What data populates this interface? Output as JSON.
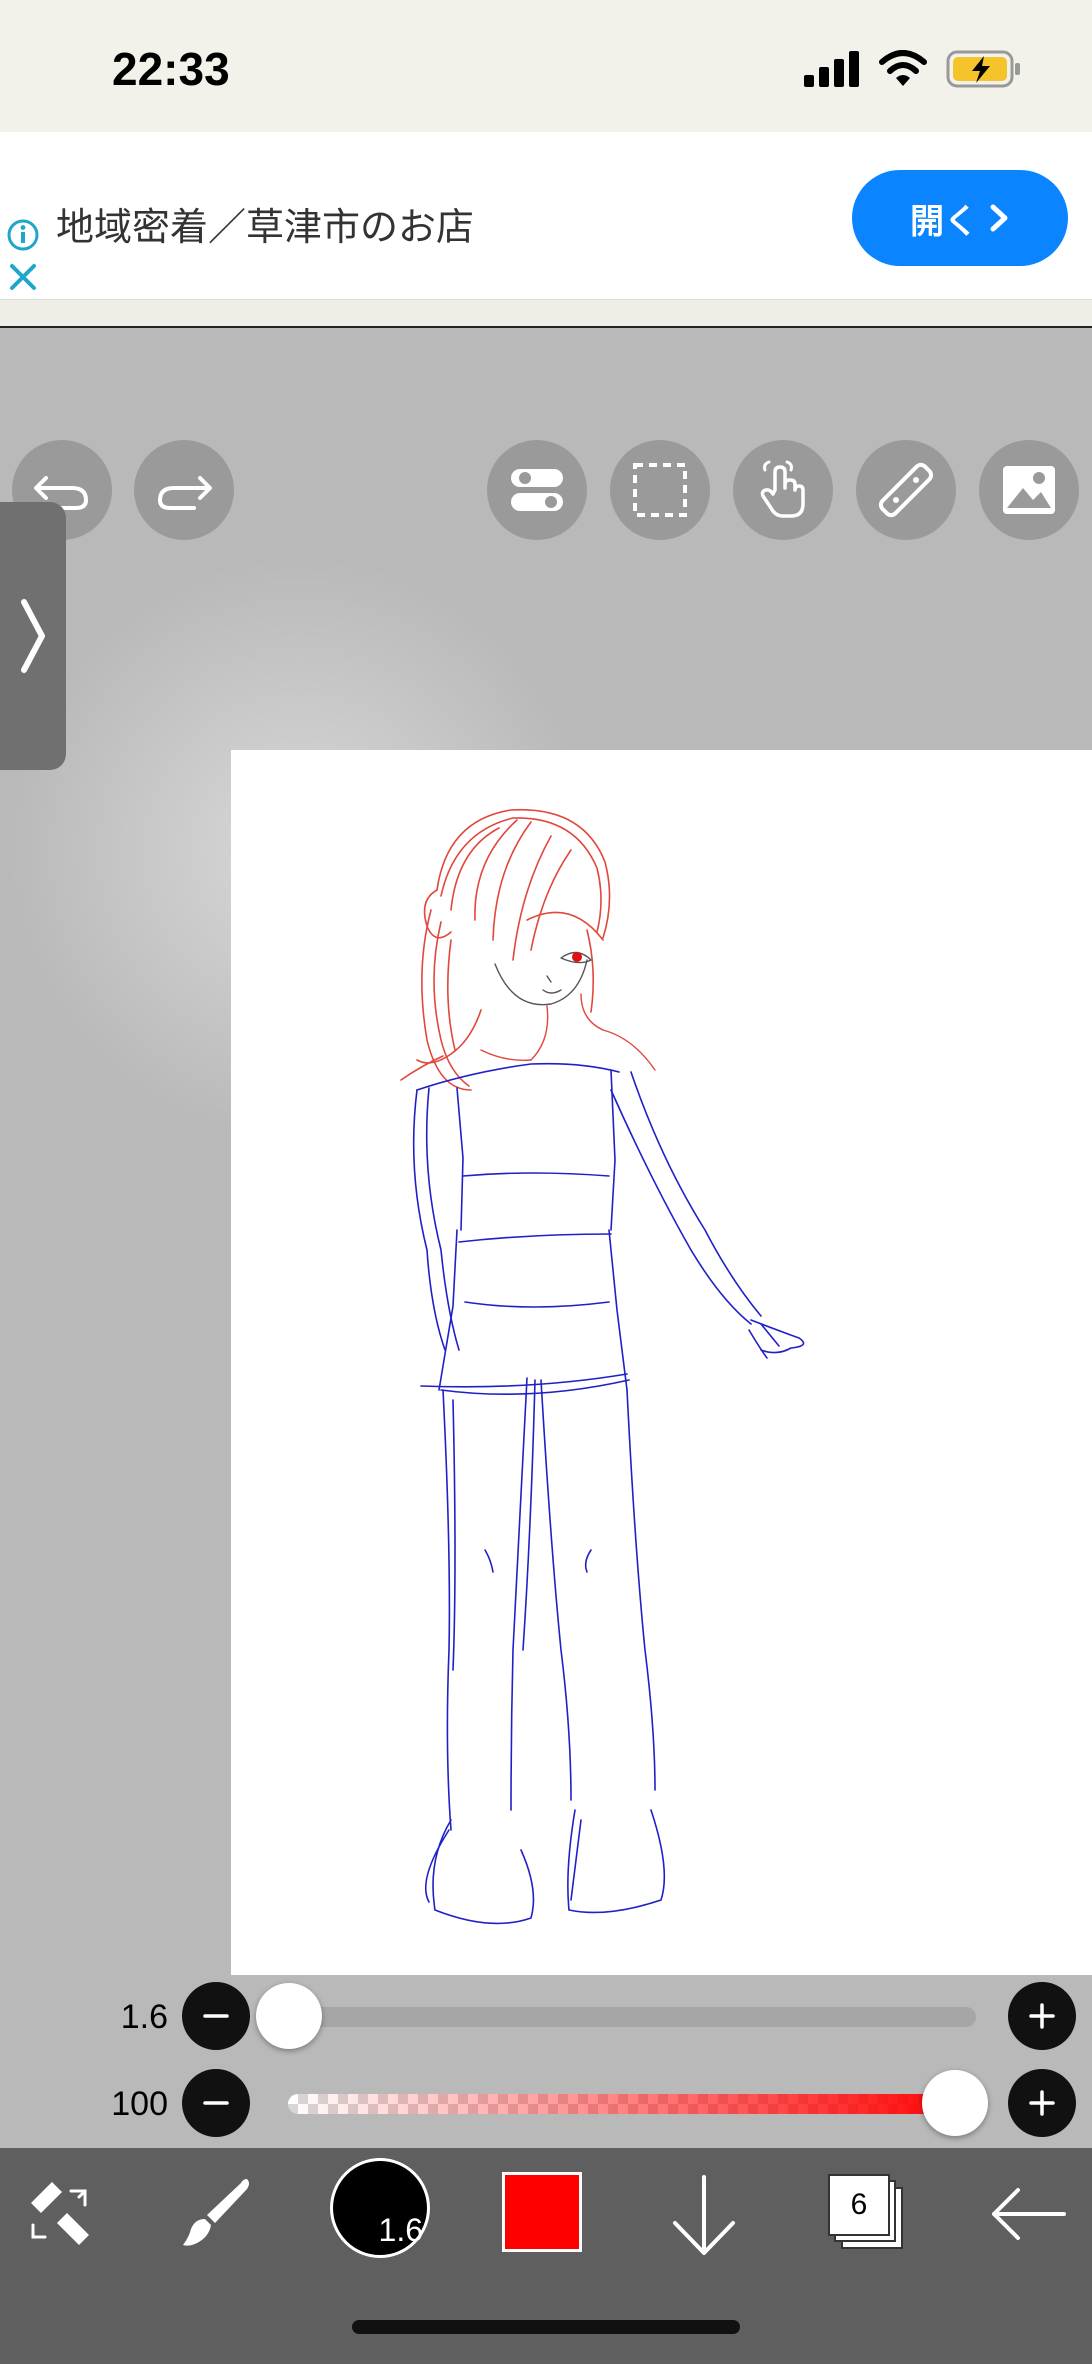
{
  "status_bar": {
    "time": "22:33",
    "icons": [
      "signal-icon",
      "wifi-icon",
      "battery-charging-icon"
    ]
  },
  "ad": {
    "text": "地域密着／草津市のお店",
    "open_button": "開く",
    "icons": [
      "info-icon",
      "close-icon",
      "chevron-right-icon"
    ]
  },
  "toolbar": {
    "left": [
      "undo-icon",
      "redo-icon"
    ],
    "right": [
      "toggle-icon",
      "selection-icon",
      "hand-icon",
      "ruler-icon",
      "image-icon"
    ]
  },
  "sliders": {
    "brush_size": {
      "value": "1.6",
      "level": 0.0
    },
    "opacity": {
      "value": "100",
      "level": 1.0
    }
  },
  "bottom_bar": {
    "brush_size": "1.6",
    "layer_count": "6",
    "colors": {
      "primary": "#ff0000",
      "bar": "#5f5f5f"
    },
    "icons": [
      "transform-eraser-icon",
      "brush-icon",
      "arrow-down-icon",
      "layers-icon",
      "back-arrow-icon"
    ]
  }
}
